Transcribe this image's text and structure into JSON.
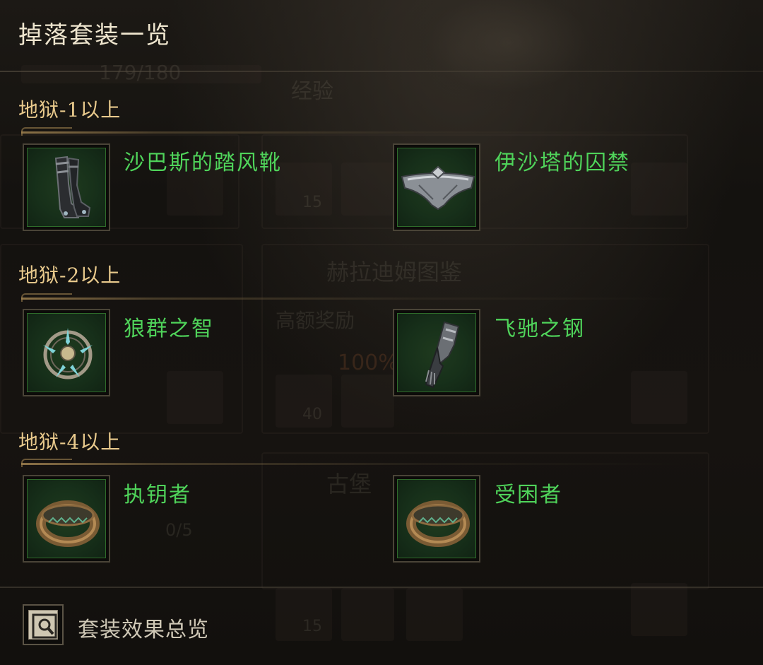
{
  "title": "掉落套装一览",
  "tiers": [
    {
      "heading": "地狱-1以上",
      "items": [
        {
          "name": "沙巴斯的踏风靴",
          "icon": "boots-icon"
        },
        {
          "name": "伊沙塔的囚禁",
          "icon": "belt-icon"
        }
      ]
    },
    {
      "heading": "地狱-2以上",
      "items": [
        {
          "name": "狼群之智",
          "icon": "amulet-icon"
        },
        {
          "name": "飞驰之钢",
          "icon": "gauntlet-icon"
        }
      ]
    },
    {
      "heading": "地狱-4以上",
      "items": [
        {
          "name": "执钥者",
          "icon": "ring-icon"
        },
        {
          "name": "受困者",
          "icon": "ring-icon"
        }
      ]
    }
  ],
  "footer": {
    "label": "套装效果总览",
    "icon": "set-overview-icon"
  },
  "background": {
    "progress_text": "179/180",
    "exp_label": "经验",
    "codex_label": "赫拉迪姆图鉴",
    "reward_text": "高额奖励",
    "percent_text": "100%",
    "castle_text": "古堡",
    "count_a": "15",
    "count_b": "40",
    "count_c": "15",
    "fraction_text": "0/5"
  },
  "colors": {
    "item_name": "#4fd35a",
    "tier_heading": "#e8c98c",
    "title": "#efe6cf",
    "slot_bg": "#17301a"
  }
}
